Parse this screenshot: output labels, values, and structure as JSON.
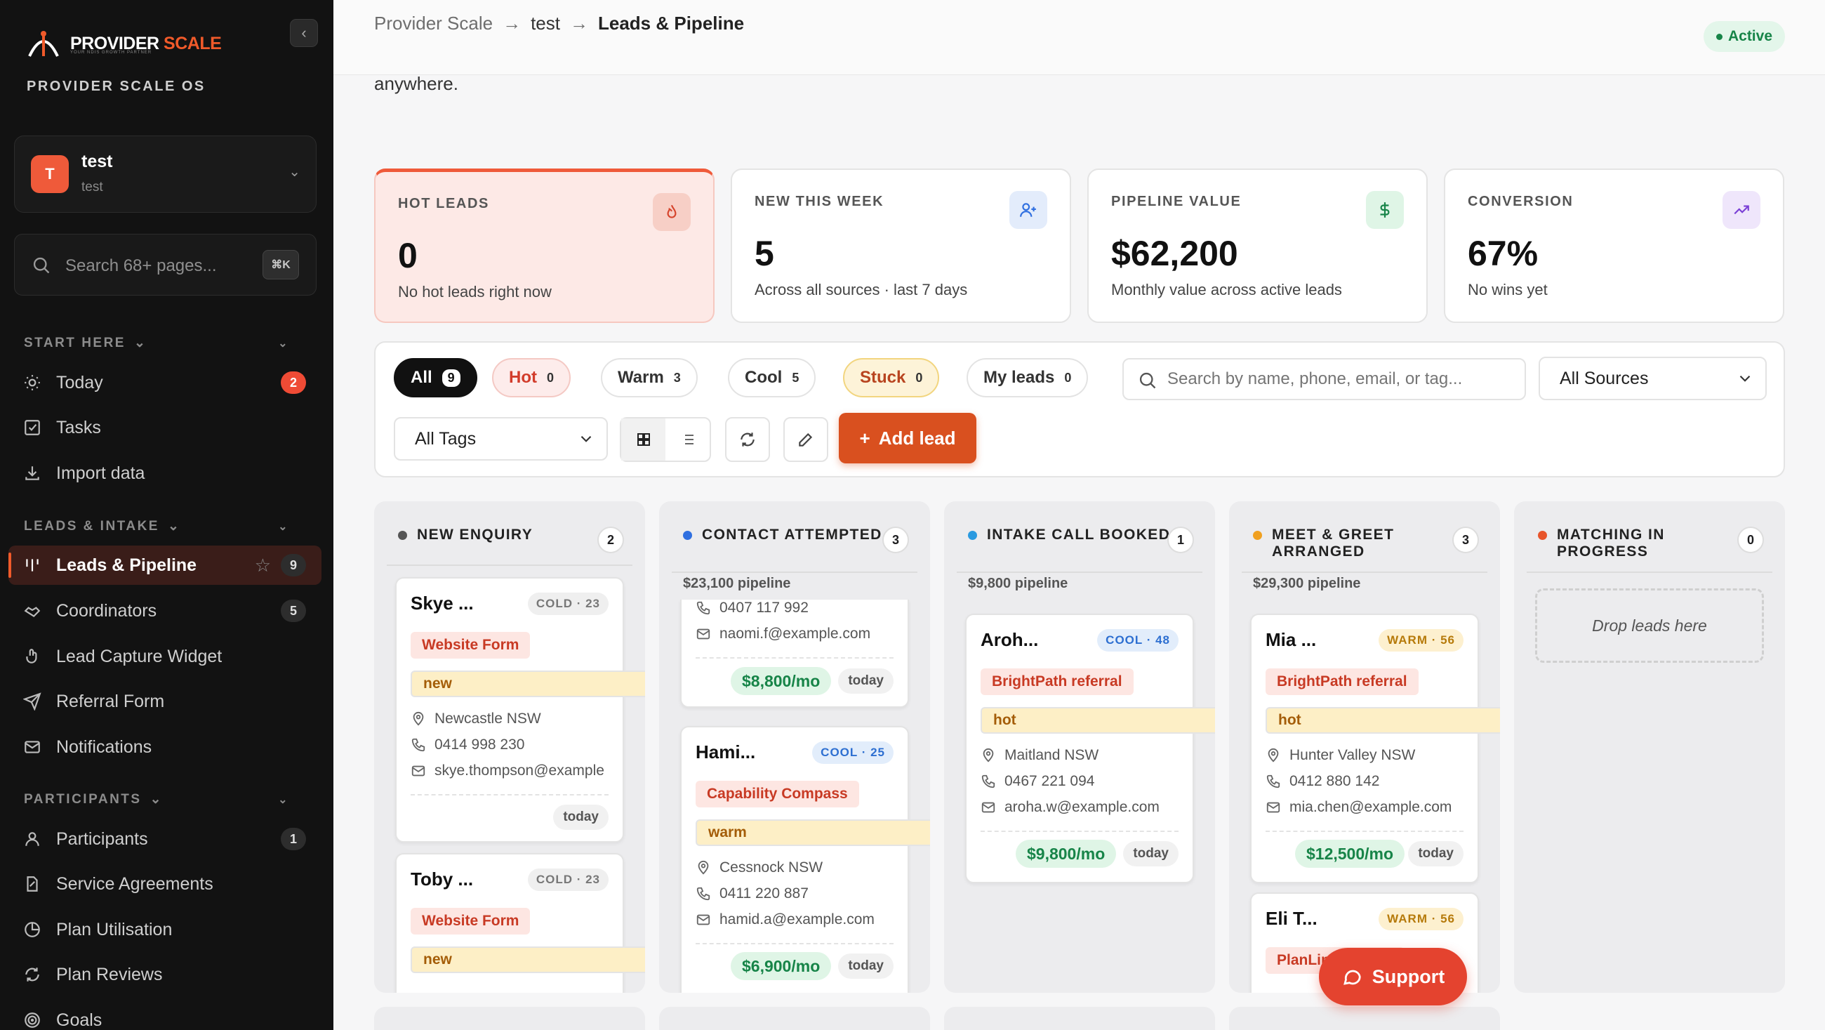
{
  "brand": {
    "name_part1": "PROVIDER ",
    "name_part2": "SCALE",
    "tagline": "YOUR NDIS GROWTH PARTNER",
    "os_label": "PROVIDER SCALE OS"
  },
  "workspace": {
    "initial": "T",
    "name": "test",
    "sub": "test"
  },
  "side_search": {
    "placeholder": "Search 68+ pages...",
    "shortcut": "⌘K"
  },
  "sections": {
    "start": "START HERE",
    "leads": "LEADS & INTAKE",
    "participants": "PARTICIPANTS"
  },
  "nav": {
    "today": {
      "label": "Today",
      "count": "2"
    },
    "tasks": {
      "label": "Tasks"
    },
    "import": {
      "label": "Import data"
    },
    "leads": {
      "label": "Leads & Pipeline",
      "count": "9"
    },
    "coordinators": {
      "label": "Coordinators",
      "count": "5"
    },
    "widget": {
      "label": "Lead Capture Widget"
    },
    "referral": {
      "label": "Referral Form"
    },
    "notifications": {
      "label": "Notifications"
    },
    "participants": {
      "label": "Participants",
      "count": "1"
    },
    "agreements": {
      "label": "Service Agreements"
    },
    "utilisation": {
      "label": "Plan Utilisation"
    },
    "reviews": {
      "label": "Plan Reviews"
    },
    "goals": {
      "label": "Goals"
    }
  },
  "breadcrumb": {
    "root": "Provider Scale",
    "workspace": "test",
    "page": "Leads & Pipeline"
  },
  "status": "Active",
  "intro_tail": "anywhere.",
  "stats": {
    "hot": {
      "label": "HOT LEADS",
      "value": "0",
      "sub": "No hot leads right now"
    },
    "new": {
      "label": "NEW THIS WEEK",
      "value": "5",
      "sub": "Across all sources · last 7 days"
    },
    "pipeline": {
      "label": "PIPELINE VALUE",
      "value": "$62,200",
      "sub": "Monthly value across active leads"
    },
    "conversion": {
      "label": "CONVERSION",
      "value": "67%",
      "sub": "No wins yet"
    }
  },
  "filters": {
    "all": {
      "label": "All",
      "count": "9"
    },
    "hot": {
      "label": "Hot",
      "count": "0"
    },
    "warm": {
      "label": "Warm",
      "count": "3"
    },
    "cool": {
      "label": "Cool",
      "count": "5"
    },
    "stuck": {
      "label": "Stuck",
      "count": "0"
    },
    "mine": {
      "label": "My leads",
      "count": "0"
    },
    "search_placeholder": "Search by name, phone, email, or tag...",
    "sources": "All Sources",
    "tags": "All Tags",
    "add": "Add lead"
  },
  "columns": {
    "new": {
      "title": "NEW ENQUIRY",
      "count": "2",
      "color": "#555555"
    },
    "contact": {
      "title": "CONTACT ATTEMPTED",
      "count": "3",
      "pipeline": "$23,100 pipeline",
      "color": "#2f6fe0"
    },
    "intake": {
      "title": "INTAKE CALL BOOKED",
      "count": "1",
      "pipeline": "$9,800 pipeline",
      "color": "#2a9ae0"
    },
    "meet": {
      "title": "MEET & GREET ARRANGED",
      "count": "3",
      "pipeline": "$29,300 pipeline",
      "color": "#f0a020"
    },
    "matching": {
      "title": "MATCHING IN PROGRESS",
      "count": "0",
      "color": "#e8552b",
      "drop": "Drop leads here"
    }
  },
  "cards": {
    "skye": {
      "name": "Skye ...",
      "score": "COLD · 23",
      "source": "Website Form",
      "status": "new",
      "location": "Newcastle NSW",
      "phone": "0414 998 230",
      "email": "skye.thompson@example",
      "when": "today"
    },
    "toby": {
      "name": "Toby ...",
      "score": "COLD · 23",
      "source": "Website Form",
      "status": "new"
    },
    "naomi": {
      "phone": "0407 117 992",
      "email": "naomi.f@example.com",
      "value": "$8,800/mo",
      "when": "today"
    },
    "hami": {
      "name": "Hami...",
      "score": "COOL · 25",
      "source": "Capability Compass",
      "status": "warm",
      "location": "Cessnock NSW",
      "phone": "0411 220 887",
      "email": "hamid.a@example.com",
      "value": "$6,900/mo",
      "when": "today"
    },
    "aroh": {
      "name": "Aroh...",
      "score": "COOL · 48",
      "source": "BrightPath referral",
      "status": "hot",
      "location": "Maitland NSW",
      "phone": "0467 221 094",
      "email": "aroha.w@example.com",
      "value": "$9,800/mo",
      "when": "today"
    },
    "mia": {
      "name": "Mia ...",
      "score": "WARM · 56",
      "source": "BrightPath referral",
      "status": "hot",
      "location": "Hunter Valley NSW",
      "phone": "0412 880 142",
      "email": "mia.chen@example.com",
      "value": "$12,500/mo",
      "when": "today"
    },
    "eli": {
      "name": "Eli T...",
      "score": "WARM · 56",
      "source": "PlanLink referral"
    }
  },
  "support": "Support"
}
